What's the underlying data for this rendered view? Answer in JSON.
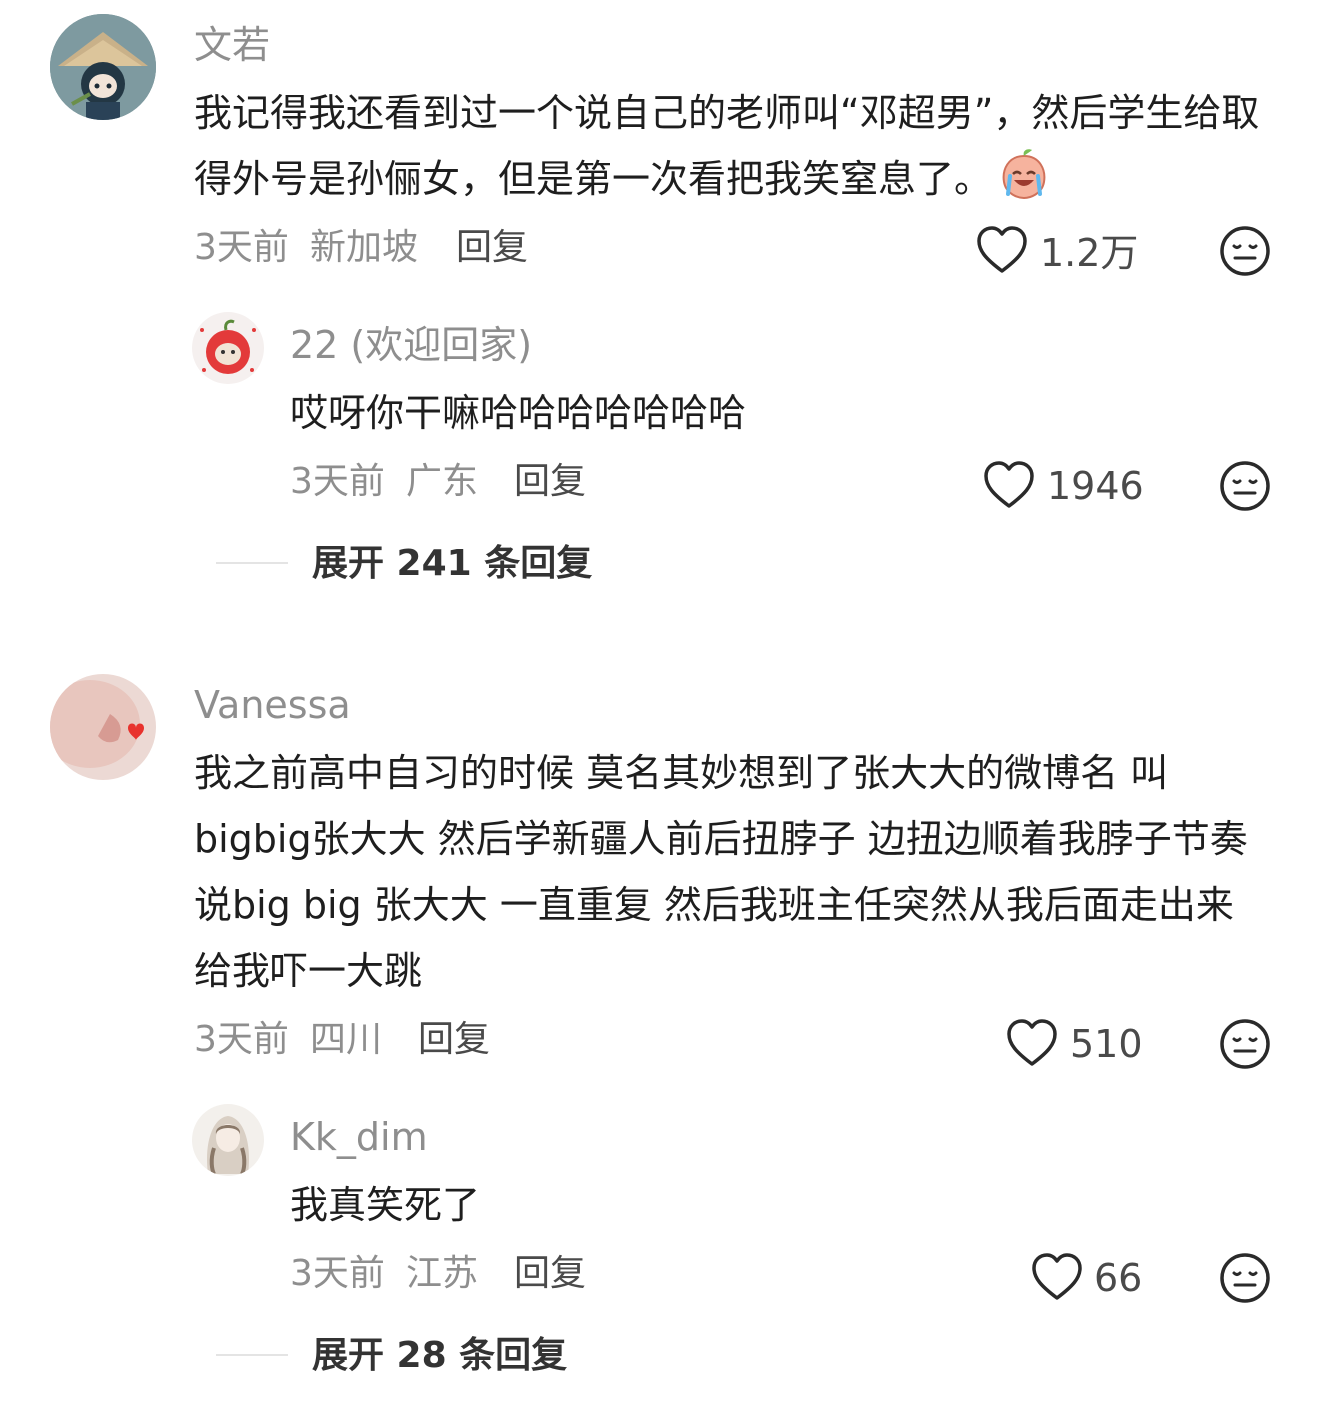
{
  "comments": [
    {
      "name": "文若",
      "text": "我记得我还看到过一个说自己的老师叫“邓超男”，然后学生给取得外号是孙俪女，但是第一次看把我笑窒息了。",
      "time": "3天前",
      "location": "新加坡",
      "reply_label": "回复",
      "likes": "1.2万",
      "reply": {
        "name": "22 (欢迎回家)",
        "text": "哎呀你干嘛哈哈哈哈哈哈哈",
        "time": "3天前",
        "location": "广东",
        "reply_label": "回复",
        "likes": "1946"
      },
      "expand": "展开 241 条回复"
    },
    {
      "name": "Vanessa",
      "text": "我之前高中自习的时候 莫名其妙想到了张大大的微博名 叫 bigbig张大大 然后学新疆人前后扭脖子 边扭边顺着我脖子节奏说big big 张大大 一直重复 然后我班主任突然从我后面走出来给我吓一大跳",
      "time": "3天前",
      "location": "四川",
      "reply_label": "回复",
      "likes": "510",
      "reply": {
        "name": "Kk_dim",
        "text": "我真笑死了",
        "time": "3天前",
        "location": "江苏",
        "reply_label": "回复",
        "likes": "66"
      },
      "expand": "展开 28 条回复"
    }
  ],
  "icons": {
    "like": "heart-outline-icon",
    "dislike": "neutral-face-icon",
    "emoji": "crying-laughing-peach-emoji"
  },
  "colors": {
    "secondary_text": "#8e8e8e",
    "primary_text": "#1e1e1e",
    "divider": "#e4e4e4"
  }
}
